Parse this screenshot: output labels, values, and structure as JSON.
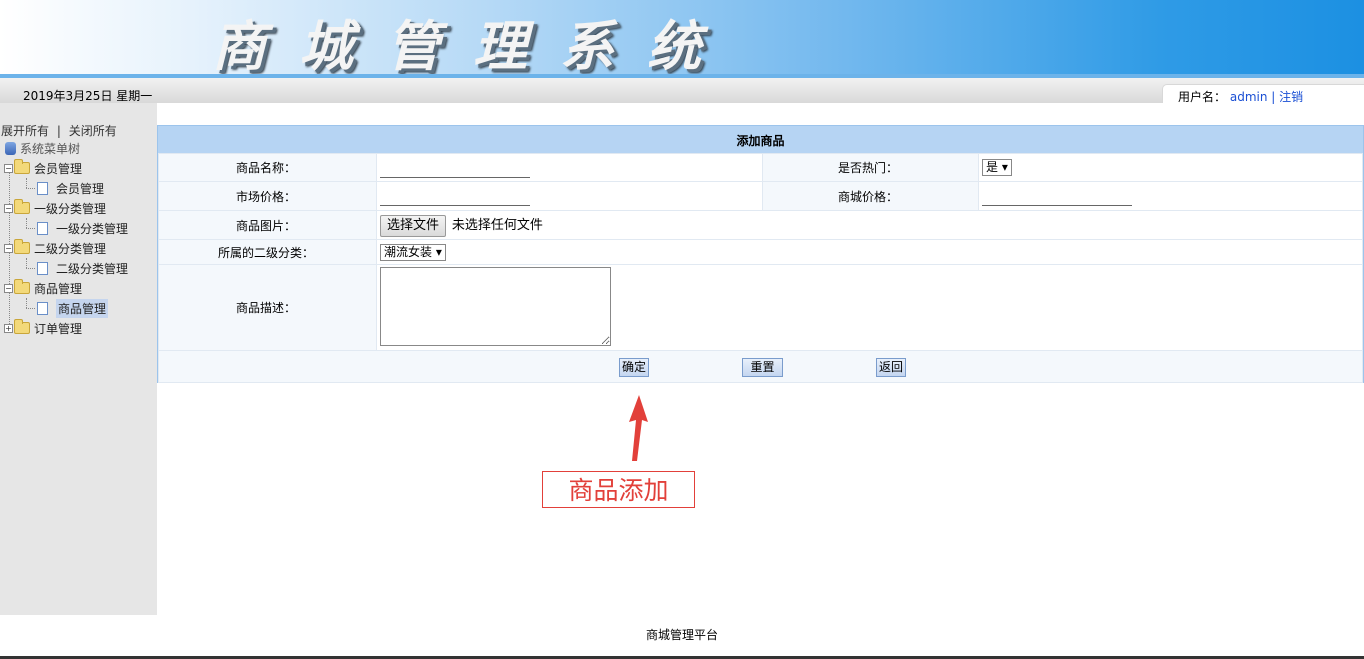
{
  "banner": {
    "title": "商城管理系统"
  },
  "infobar": {
    "date": "2019年3月25日 星期一",
    "user_label": "用户名：",
    "username": "admin",
    "separator": "|",
    "logout": "注销"
  },
  "sidebar": {
    "expand_all": "展开所有",
    "divider": "|",
    "collapse_all": "关闭所有",
    "root": "系统菜单树",
    "groups": [
      {
        "label": "会员管理",
        "expanded": true,
        "child": "会员管理"
      },
      {
        "label": "一级分类管理",
        "expanded": true,
        "child": "一级分类管理"
      },
      {
        "label": "二级分类管理",
        "expanded": true,
        "child": "二级分类管理"
      },
      {
        "label": "商品管理",
        "expanded": true,
        "child": "商品管理"
      },
      {
        "label": "订单管理",
        "expanded": false
      }
    ]
  },
  "form": {
    "title": "添加商品",
    "name_label": "商品名称：",
    "hot_label": "是否热门：",
    "hot_value": "是",
    "market_price_label": "市场价格：",
    "shop_price_label": "商城价格：",
    "image_label": "商品图片：",
    "file_button": "选择文件",
    "file_status": "未选择任何文件",
    "category_label": "所属的二级分类：",
    "category_value": "潮流女装",
    "desc_label": "商品描述：",
    "confirm": "确定",
    "reset": "重置",
    "back": "返回"
  },
  "annotation": {
    "text": "商品添加",
    "color": "#e2403a"
  },
  "footer": {
    "text": "商城管理平台"
  }
}
